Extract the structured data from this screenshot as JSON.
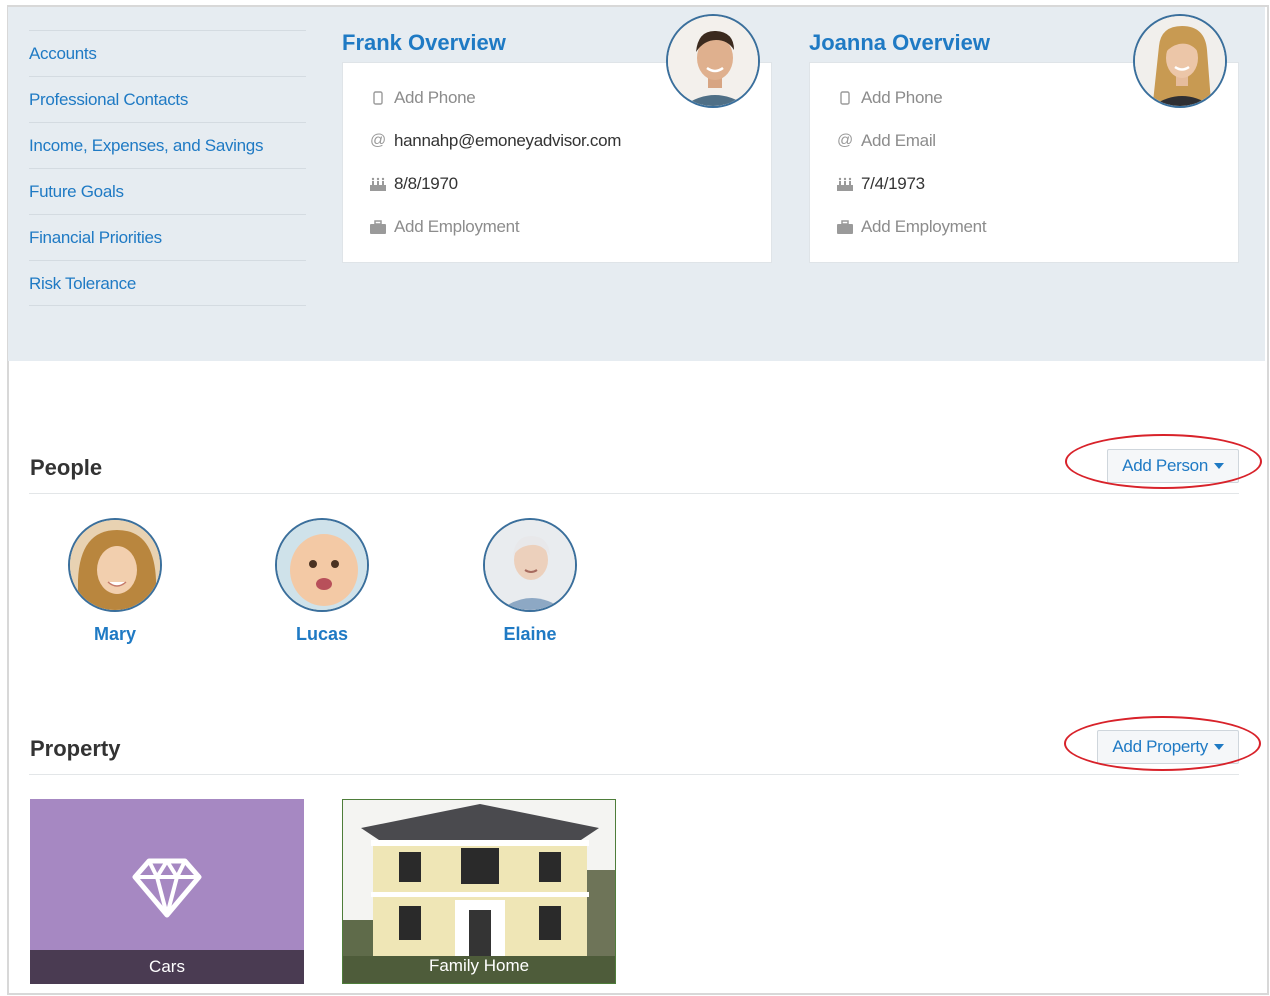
{
  "nav": {
    "items": [
      "Accounts",
      "Professional Contacts",
      "Income, Expenses, and Savings",
      "Future Goals",
      "Financial Priorities",
      "Risk Tolerance"
    ]
  },
  "frank": {
    "title": "Frank Overview",
    "phone": "Add Phone",
    "email": "hannahp@emoneyadvisor.com",
    "birthdate": "8/8/1970",
    "employment": "Add Employment"
  },
  "joanna": {
    "title": "Joanna Overview",
    "phone": "Add Phone",
    "email": "Add Email",
    "birthdate": "7/4/1973",
    "employment": "Add Employment"
  },
  "people": {
    "title": "People",
    "add_label": "Add Person",
    "members": [
      "Mary",
      "Lucas",
      "Elaine"
    ]
  },
  "property": {
    "title": "Property",
    "add_label": "Add Property",
    "items": [
      "Cars",
      "Family Home"
    ]
  },
  "colors": {
    "link": "#1f7ac4",
    "band": "#e6ecf1",
    "highlight": "#d8222a",
    "cars_tile": "#a688c2"
  },
  "icons": [
    "phone-icon",
    "at-icon",
    "cake-icon",
    "briefcase-icon",
    "diamond-icon",
    "caret-down-icon"
  ]
}
